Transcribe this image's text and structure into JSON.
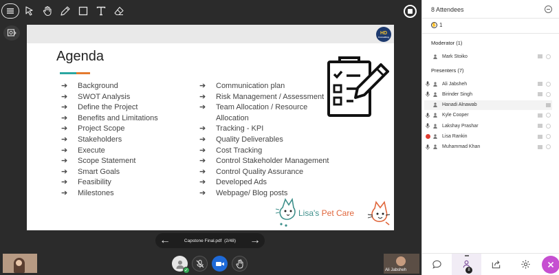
{
  "toolbar": {
    "tools": [
      {
        "name": "menu-icon"
      },
      {
        "name": "pointer-icon"
      },
      {
        "name": "hand-icon"
      },
      {
        "name": "pen-icon"
      },
      {
        "name": "square-icon"
      },
      {
        "name": "text-icon"
      },
      {
        "name": "eraser-icon"
      }
    ]
  },
  "slide": {
    "title": "Agenda",
    "logo_text": "HD",
    "logo_sub": "Consulting",
    "agenda_left": [
      "Background",
      "SWOT Analysis",
      "Define the Project",
      "Benefits and Limitations",
      "Project Scope",
      "Stakeholders",
      "Execute",
      "Scope Statement",
      "Smart Goals",
      "Feasibility",
      "Milestones"
    ],
    "agenda_right": [
      "Communication plan",
      "Risk Management / Assessment",
      "Team Allocation / Resource Allocation",
      "Tracking  - KPI",
      " Quality Deliverables",
      "Cost Tracking",
      "Control Stakeholder Management",
      "Control Quality Assurance",
      "Developed Ads",
      "Webpage/ Blog posts"
    ],
    "brand_name_a": "Lisa's ",
    "brand_name_b": "Pet Care",
    "arrow_glyph": "➔"
  },
  "page_nav": {
    "file_name": "Capstone Final.pdf",
    "page_indicator": "(2/48)",
    "prev_glyph": "←",
    "next_glyph": "→"
  },
  "remote_video": {
    "label": "Ali Jabsheh"
  },
  "panel": {
    "title": "8 Attendees",
    "hand_count": "1",
    "moderator_title": "Moderator (1)",
    "moderators": [
      {
        "name": "Mark Stoiko",
        "mic": false,
        "recording": false
      }
    ],
    "presenters_title": "Presenters (7)",
    "presenters": [
      {
        "name": "Ali Jabsheh",
        "mic": true,
        "recording": false,
        "highlight": false
      },
      {
        "name": "Birinder Singh",
        "mic": true,
        "recording": false,
        "highlight": false
      },
      {
        "name": "Hanadi Alnawab",
        "mic": false,
        "recording": false,
        "highlight": true
      },
      {
        "name": "Kyle Cooper",
        "mic": true,
        "recording": false,
        "highlight": false
      },
      {
        "name": "Lakshay Prashar",
        "mic": true,
        "recording": false,
        "highlight": false
      },
      {
        "name": "Lisa Rankin",
        "mic": false,
        "recording": true,
        "highlight": false
      },
      {
        "name": "Muhammad Khan",
        "mic": true,
        "recording": false,
        "highlight": false
      }
    ],
    "tab_badge": "8"
  },
  "colors": {
    "accent": "#c64fd1",
    "camera": "#1e6ad8",
    "recording": "#e03c31",
    "online": "#34a853"
  }
}
